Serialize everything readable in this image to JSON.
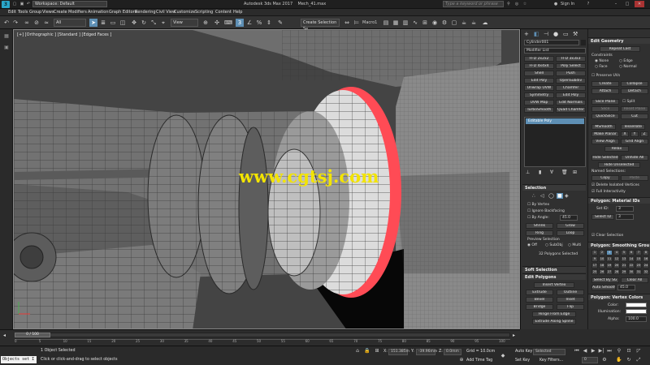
{
  "title_bar": {
    "logo": "3",
    "workspace": "Workspace: Default",
    "title": "Autodesk 3ds Max 2017",
    "filename": "Mech_41.max",
    "search_placeholder": "Type a keyword or phrase",
    "sign_in": "Sign In"
  },
  "menu": [
    "Edit",
    "Tools",
    "Group",
    "Views",
    "Create",
    "Modifiers",
    "Animation",
    "Graph Editors",
    "Rendering",
    "Civil View",
    "Customize",
    "Scripting",
    "Content",
    "Help"
  ],
  "toolbar": {
    "filter": "All",
    "view": "View",
    "create_selection": "Create Selection Se",
    "macro": "Macro1"
  },
  "viewport": {
    "label": "[+] [Orthographic ] [Standard ] [Edged Faces ]",
    "watermark": "www.cgtsj.com"
  },
  "command_panel": {
    "object_name": "Cylinder001",
    "modifier_list": "Modifier List",
    "modifier_buttons": [
      [
        "FFD 2x2x2",
        "FFD 3x3x3"
      ],
      [
        "FFD 4x4x4",
        "Poly Select"
      ],
      [
        "Shell",
        "Push"
      ],
      [
        "Edit Poly",
        "OpenSubdiv"
      ],
      [
        "Unwrap UVW",
        "Chamfer"
      ],
      [
        "Symmetry",
        "Edit Poly"
      ],
      [
        "UVW Map",
        "Edit Normals"
      ],
      [
        "TurboSmooth",
        "Quad Chamfer"
      ]
    ],
    "stack_item": "Editable Poly",
    "selection": {
      "header": "Selection",
      "by_vertex": "By Vertex",
      "ignore_backfacing": "Ignore Backfacing",
      "by_angle": "By Angle:",
      "angle_value": "45.0",
      "shrink": "Shrink",
      "grow": "Grow",
      "ring": "Ring",
      "loop": "Loop",
      "preview": "Preview Selection",
      "preview_off": "Off",
      "preview_subobj": "SubObj",
      "preview_multi": "Multi",
      "status": "32 Polygons Selected"
    },
    "soft_selection": "Soft Selection",
    "edit_polygons": {
      "header": "Edit Polygons",
      "insert_vertex": "Insert Vertex",
      "rows": [
        [
          "Extrude",
          "Outline"
        ],
        [
          "Bevel",
          "Inset"
        ],
        [
          "Bridge",
          "Flip"
        ]
      ],
      "hinge": "Hinge From Edge",
      "extrude_spline": "Extrude Along Spline",
      "edit_tri": "Edit Triangulation",
      "retriangulate": "Retriangulate",
      "turn": "Turn"
    }
  },
  "geometry_panel": {
    "header": "Edit Geometry",
    "repeat_last": "Repeat Last",
    "constraints": "Constraints",
    "c_none": "None",
    "c_edge": "Edge",
    "c_face": "Face",
    "c_normal": "Normal",
    "preserve_uvs": "Preserve UVs",
    "create": "Create",
    "collapse": "Collapse",
    "attach": "Attach",
    "detach": "Detach",
    "slice_plane": "Slice Plane",
    "split": "Split",
    "slice": "Slice",
    "reset_plane": "Reset Plane",
    "quickslice": "QuickSlice",
    "cut": "Cut",
    "msmooth": "MSmooth",
    "tessellate": "Tessellate",
    "make_planar": "Make Planar",
    "x": "X",
    "y": "Y",
    "z": "Z",
    "view_align": "View Align",
    "grid_align": "Grid Align",
    "relax": "Relax",
    "hide_selected": "Hide Selected",
    "unhide_all": "Unhide All",
    "hide_unselected": "Hide Unselected",
    "named_selections": "Named Selections:",
    "copy": "Copy",
    "paste": "Paste",
    "delete_isolated": "Delete Isolated Vertices",
    "full_interactivity": "Full Interactivity",
    "material_header": "Polygon: Material IDs",
    "set_id": "Set ID:",
    "set_id_val": "3",
    "select_id": "Select ID",
    "select_id_val": "3",
    "clear_selection": "Clear Selection",
    "smoothing_header": "Polygon: Smoothing Grou",
    "smoothing_groups": [
      "1",
      "2",
      "3",
      "4",
      "5",
      "6",
      "7",
      "8",
      "9",
      "10",
      "11",
      "12",
      "13",
      "14",
      "15",
      "16",
      "17",
      "18",
      "19",
      "20",
      "21",
      "22",
      "23",
      "24",
      "25",
      "26",
      "27",
      "28",
      "29",
      "30",
      "31",
      "32"
    ],
    "select_by_sg": "Select By SG",
    "clear_all": "Clear All",
    "auto_smooth": "Auto Smooth",
    "auto_smooth_val": "45.0",
    "vertex_colors_header": "Polygon: Vertex Colors",
    "color": "Color:",
    "illumination": "Illumination:",
    "alpha": "Alpha:",
    "alpha_val": "100.0",
    "subdivision_header": "Subdivision Surface",
    "smooth_result": "Smooth Result"
  },
  "timeline": {
    "frame": "0 / 100",
    "ticks": [
      "0",
      "5",
      "10",
      "15",
      "20",
      "25",
      "30",
      "35",
      "40",
      "45",
      "50",
      "55",
      "60",
      "65",
      "70",
      "75",
      "80",
      "85",
      "90",
      "95",
      "100"
    ]
  },
  "status": {
    "script": "Objects set I",
    "selected": "1 Object Selected",
    "prompt": "Click or click-and-drag to select objects",
    "x_label": "X:",
    "x_val": "151.385m",
    "y_label": "Y:",
    "y_val": "-39.96mm",
    "z_label": "Z:",
    "z_val": "0.0mm",
    "grid": "Grid = 10.0cm",
    "add_time_tag": "Add Time Tag",
    "auto_key": "Auto Key",
    "set_key": "Set Key",
    "selected_dd": "Selected",
    "key_filters": "Key Filters...",
    "frame_val": "0"
  },
  "colors": {
    "accent": "#5e8fb4",
    "selection_red": "#ff4b55",
    "watermark": "#f3e400"
  }
}
